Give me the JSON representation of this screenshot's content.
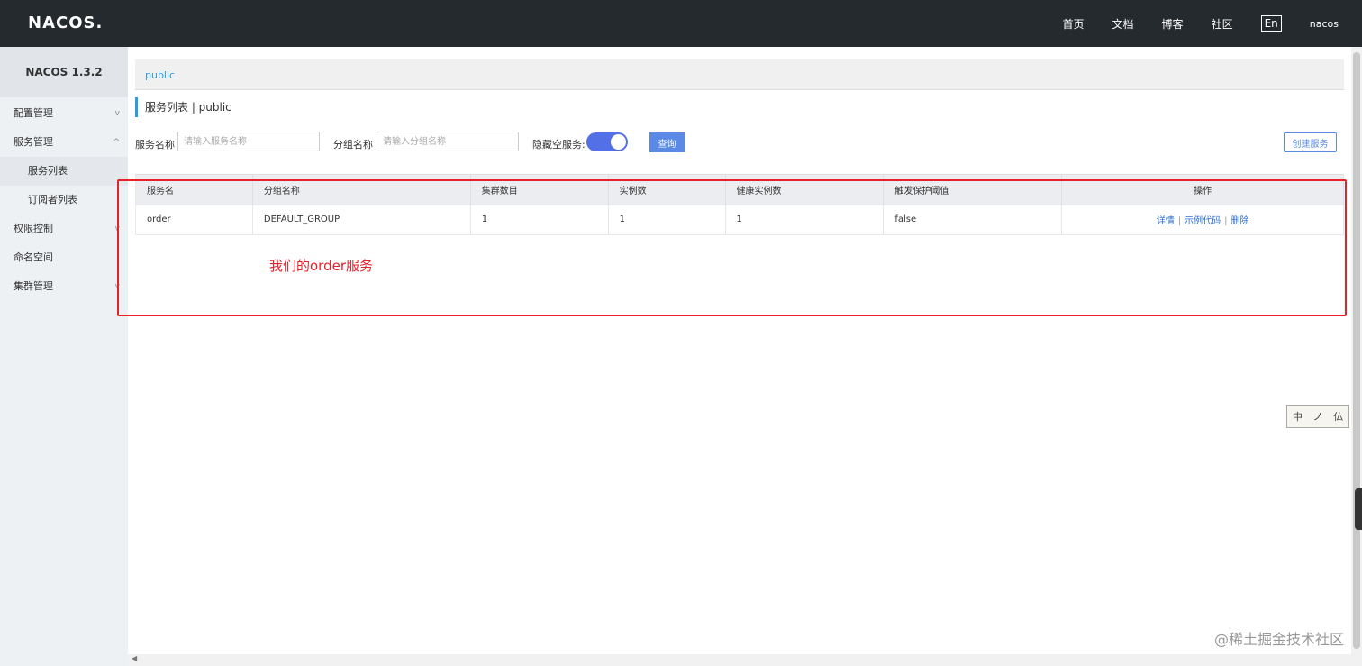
{
  "header": {
    "logo": "NACOS.",
    "nav": [
      "首页",
      "文档",
      "博客",
      "社区"
    ],
    "lang": "En",
    "user": "nacos"
  },
  "sidebar": {
    "version": "NACOS 1.3.2",
    "items": [
      {
        "label": "配置管理",
        "chevron": "v"
      },
      {
        "label": "服务管理",
        "chevron": "^"
      },
      {
        "label": "服务列表"
      },
      {
        "label": "订阅者列表"
      },
      {
        "label": "权限控制",
        "chevron": "v"
      },
      {
        "label": "命名空间"
      },
      {
        "label": "集群管理",
        "chevron": "v"
      }
    ]
  },
  "breadcrumb": "public",
  "page_title": "服务列表 | public",
  "filter": {
    "service_label": "服务名称",
    "service_placeholder": "请输入服务名称",
    "group_label": "分组名称",
    "group_placeholder": "请输入分组名称",
    "hide_empty_label": "隐藏空服务:",
    "query_button": "查询",
    "create_button": "创建服务"
  },
  "table": {
    "columns": [
      "服务名",
      "分组名称",
      "集群数目",
      "实例数",
      "健康实例数",
      "触发保护阈值",
      "操作"
    ],
    "rows": [
      {
        "name": "order",
        "group": "DEFAULT_GROUP",
        "clusters": "1",
        "instances": "1",
        "healthy": "1",
        "threshold": "false",
        "actions": [
          "详情",
          "示例代码",
          "删除"
        ],
        "separator": "|"
      }
    ]
  },
  "annotation": "我们的order服务",
  "widget": [
    "中",
    "ノ",
    "仏"
  ],
  "watermark": "@稀土掘金技术社区",
  "colors": {
    "topbar": "#252a2f",
    "accent": "#2c9ce0",
    "button": "#5a8ae6",
    "annotation": "#e8202a"
  }
}
